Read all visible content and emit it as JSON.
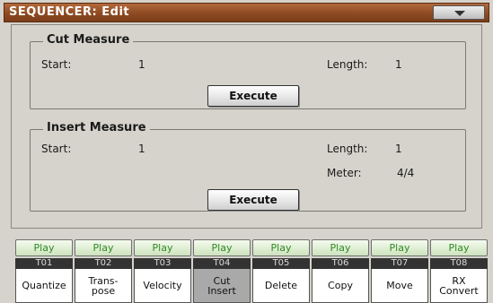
{
  "title": "SEQUENCER: Edit",
  "menu_icon": "chevron-down-icon",
  "cut_measure": {
    "title": "Cut Measure",
    "start_label": "Start:",
    "start_value": "1",
    "length_label": "Length:",
    "length_value": "1",
    "execute_label": "Execute"
  },
  "insert_measure": {
    "title": "Insert Measure",
    "start_label": "Start:",
    "start_value": "1",
    "length_label": "Length:",
    "length_value": "1",
    "meter_label": "Meter:",
    "meter_value": "4/4",
    "execute_label": "Execute"
  },
  "tracks": [
    {
      "play": "Play",
      "label": "T01"
    },
    {
      "play": "Play",
      "label": "T02"
    },
    {
      "play": "Play",
      "label": "T03"
    },
    {
      "play": "Play",
      "label": "T04"
    },
    {
      "play": "Play",
      "label": "T05"
    },
    {
      "play": "Play",
      "label": "T06"
    },
    {
      "play": "Play",
      "label": "T07"
    },
    {
      "play": "Play",
      "label": "T08"
    }
  ],
  "tabs": [
    {
      "label": "Quantize"
    },
    {
      "label": "Trans-\npose"
    },
    {
      "label": "Velocity"
    },
    {
      "label": "Cut\nInsert",
      "active": true
    },
    {
      "label": "Delete"
    },
    {
      "label": "Copy"
    },
    {
      "label": "Move"
    },
    {
      "label": "RX\nConvert"
    }
  ],
  "colors": {
    "title_bar": "#8e4a22",
    "play_text": "#2f8a25",
    "active_tab": "#a9a9a9"
  }
}
